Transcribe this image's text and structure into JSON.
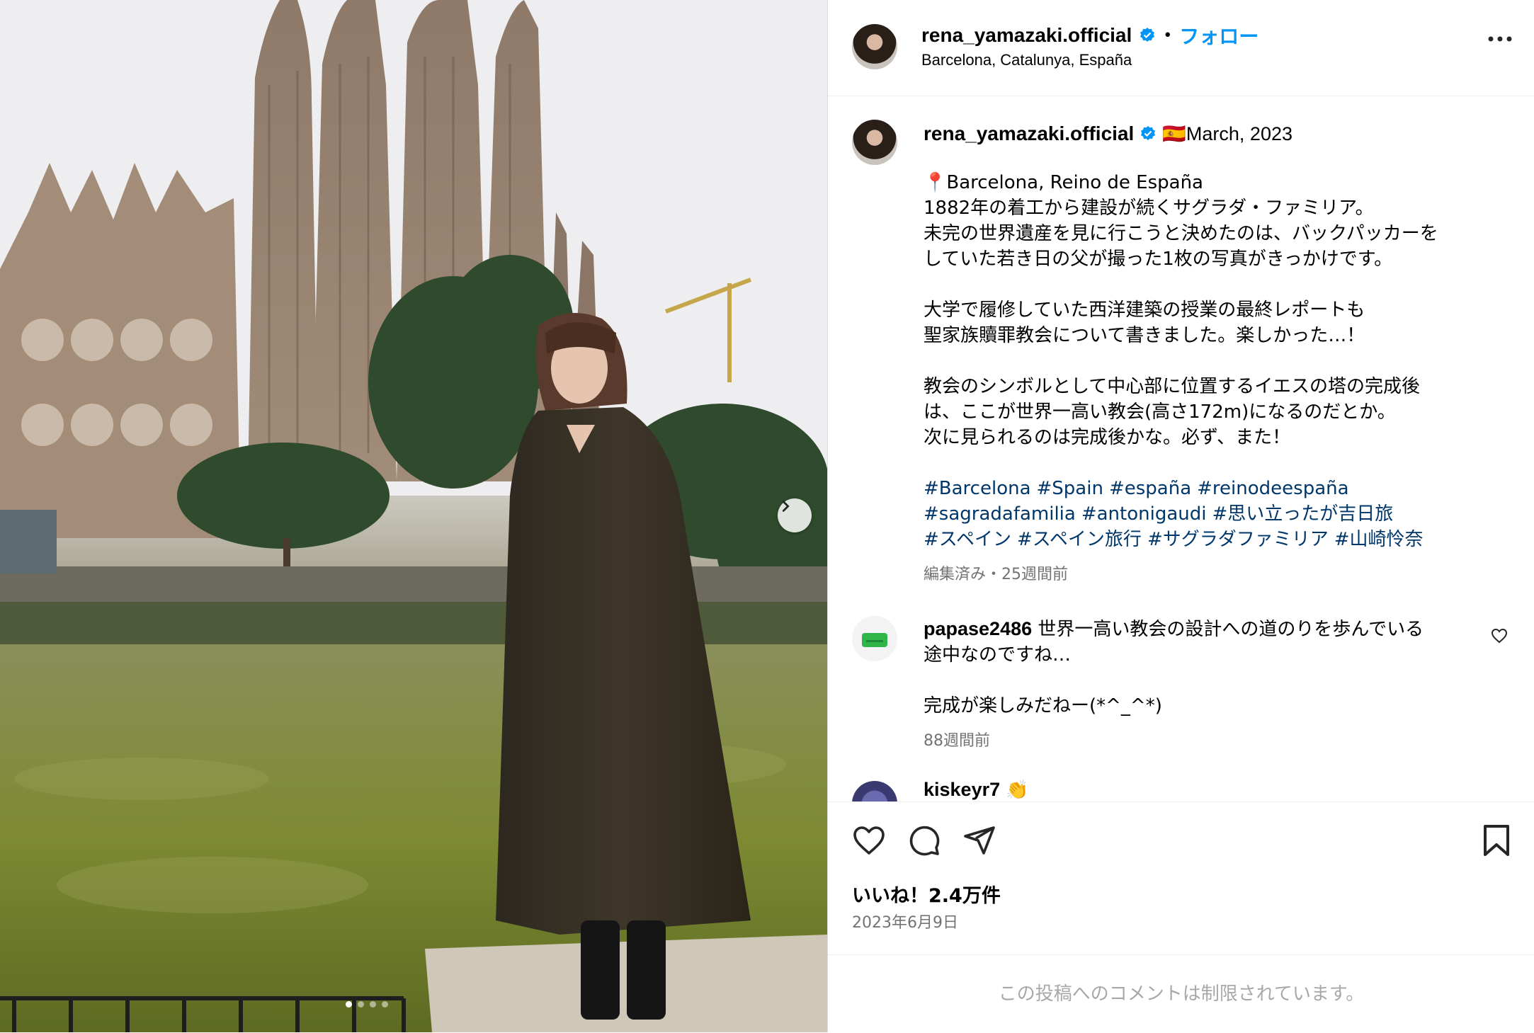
{
  "header": {
    "username": "rena_yamazaki.official",
    "separator": "•",
    "follow_label": "フォロー",
    "location": "Barcelona, Catalunya, España"
  },
  "caption": {
    "username": "rena_yamazaki.official",
    "flag": "🇪🇸",
    "date_text": "March, 2023",
    "pin": "📍",
    "lines": [
      "Barcelona, Reino de España",
      "1882年の着工から建設が続くサグラダ・ファミリア。",
      "未完の世界遺産を見に行こうと決めたのは、バックパッカーを",
      "していた若き日の父が撮った1枚の写真がきっかけです。",
      "",
      "大学で履修していた西洋建築の授業の最終レポートも",
      "聖家族贖罪教会について書きました。楽しかった…！",
      "",
      "教会のシンボルとして中心部に位置するイエスの塔の完成後",
      "は、ここが世界一高い教会(高さ172m)になるのだとか。",
      "次に見られるのは完成後かな。必ず、また！"
    ],
    "hashtags": [
      [
        "#Barcelona",
        "#Spain",
        "#españa",
        "#reinodeespaña"
      ],
      [
        "#sagradafamilia",
        "#antonigaudi",
        "#思い立ったが吉日旅"
      ],
      [
        "#スペイン",
        "#スペイン旅行",
        "#サグラダファミリア",
        "#山崎怜奈"
      ]
    ],
    "meta": "編集済み・25週間前"
  },
  "comments": [
    {
      "username": "papase2486",
      "lines": [
        "世界一高い教会の設計への道のりを歩んでいる",
        "途中なのですね…",
        "",
        "完成が楽しみだねー(*^_^*)"
      ],
      "time": "88週間前"
    },
    {
      "username": "kiskeyr7",
      "emoji": "👏"
    }
  ],
  "actions": {
    "likes": "いいね！2.4万件",
    "date": "2023年6月9日"
  },
  "footer": {
    "restricted": "この投稿へのコメントは制限されています。"
  },
  "colors": {
    "accent": "#0095f6",
    "hashtag": "#00376b",
    "muted": "#737373"
  },
  "carousel": {
    "dots": 4,
    "active_index": 0
  }
}
